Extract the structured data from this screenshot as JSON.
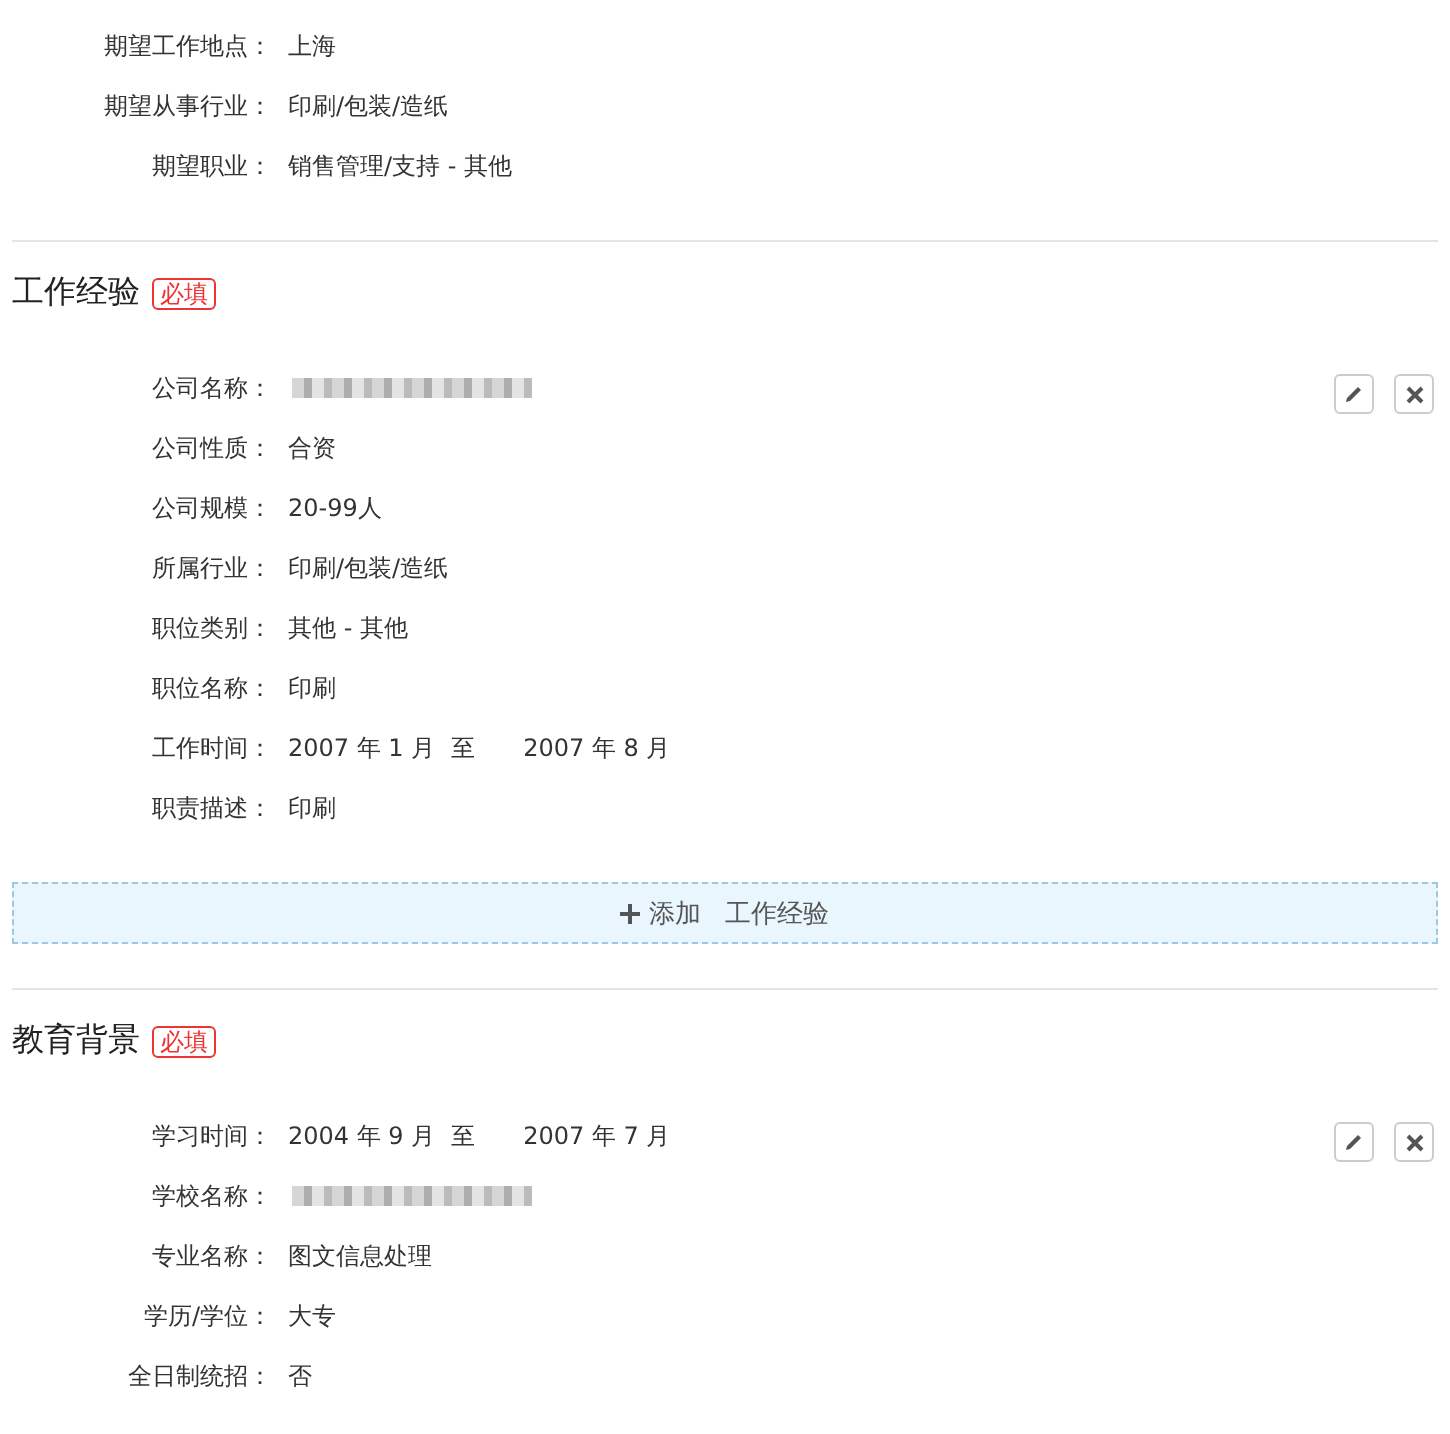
{
  "intent": {
    "fields": [
      {
        "label": "期望工作地点：",
        "value": "上海"
      },
      {
        "label": "期望从事行业：",
        "value": "印刷/包装/造纸"
      },
      {
        "label": "期望职业：",
        "value": "销售管理/支持 - 其他"
      }
    ]
  },
  "sections": [
    {
      "title": "工作经验",
      "badge": "必填",
      "entries": [
        {
          "fields": [
            {
              "kind": "redacted",
              "label": "公司名称："
            },
            {
              "kind": "text",
              "label": "公司性质：",
              "value": "合资"
            },
            {
              "kind": "text",
              "label": "公司规模：",
              "value": "20-99人"
            },
            {
              "kind": "text",
              "label": "所属行业：",
              "value": "印刷/包装/造纸"
            },
            {
              "kind": "text",
              "label": "职位类别：",
              "value": "其他 - 其他"
            },
            {
              "kind": "text",
              "label": "职位名称：",
              "value": "印刷"
            },
            {
              "kind": "range",
              "label": "工作时间：",
              "start": "2007 年 1 月",
              "separator": "至",
              "end": "2007 年 8 月"
            },
            {
              "kind": "text",
              "label": "职责描述：",
              "value": "印刷"
            }
          ]
        }
      ],
      "add_button": {
        "action": "添加",
        "target": "工作经验"
      }
    },
    {
      "title": "教育背景",
      "badge": "必填",
      "entries": [
        {
          "fields": [
            {
              "kind": "range",
              "label": "学习时间：",
              "start": "2004 年 9 月",
              "separator": "至",
              "end": "2007 年 7 月"
            },
            {
              "kind": "redacted",
              "label": "学校名称："
            },
            {
              "kind": "text",
              "label": "专业名称：",
              "value": "图文信息处理"
            },
            {
              "kind": "text",
              "label": "学历/学位：",
              "value": "大专"
            },
            {
              "kind": "text",
              "label": "全日制统招：",
              "value": "否"
            }
          ]
        }
      ]
    }
  ]
}
